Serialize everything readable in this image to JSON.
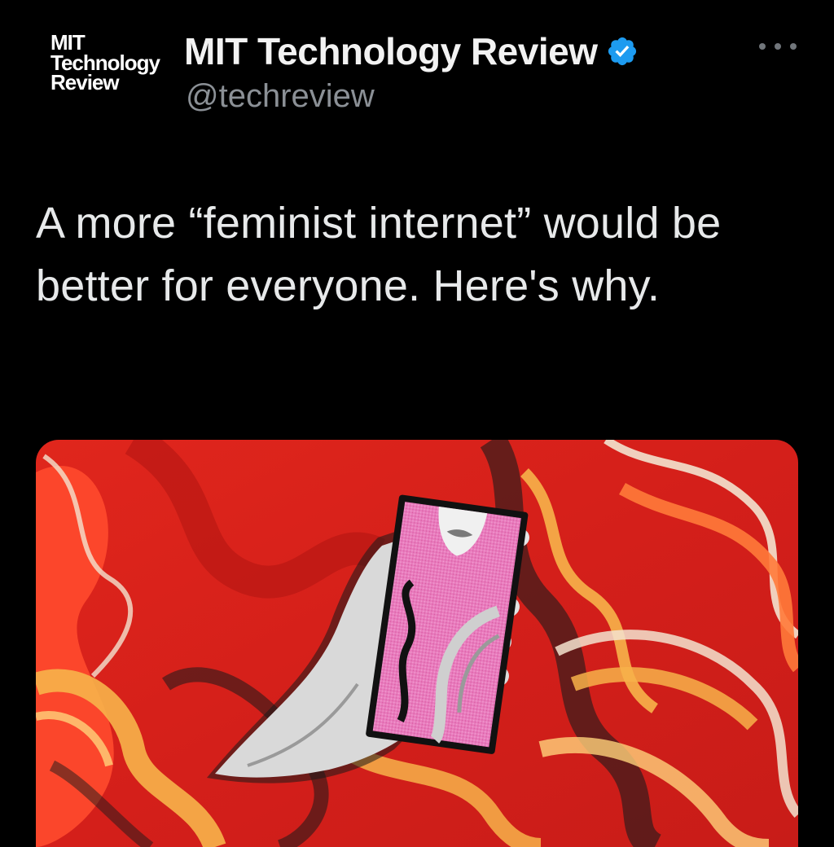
{
  "tweet": {
    "author": {
      "logo_lines": [
        "MIT",
        "Technology",
        "Review"
      ],
      "display_name": "MIT Technology Review",
      "handle": "@techreview",
      "verified": true,
      "verified_color": "#1d9bf0"
    },
    "more_icon": "more-horizontal-icon",
    "text": "A more “feminist internet” would be better for everyone. Here's why.",
    "media": {
      "kind": "illustration",
      "palette": [
        "#d8261f",
        "#ff4a2e",
        "#f7b24a",
        "#f3e3cf",
        "#1a1a1a",
        "#e96fb4"
      ]
    }
  },
  "theme": {
    "background": "#000000",
    "text": "#e7e9ea",
    "secondary": "#8b9096"
  }
}
